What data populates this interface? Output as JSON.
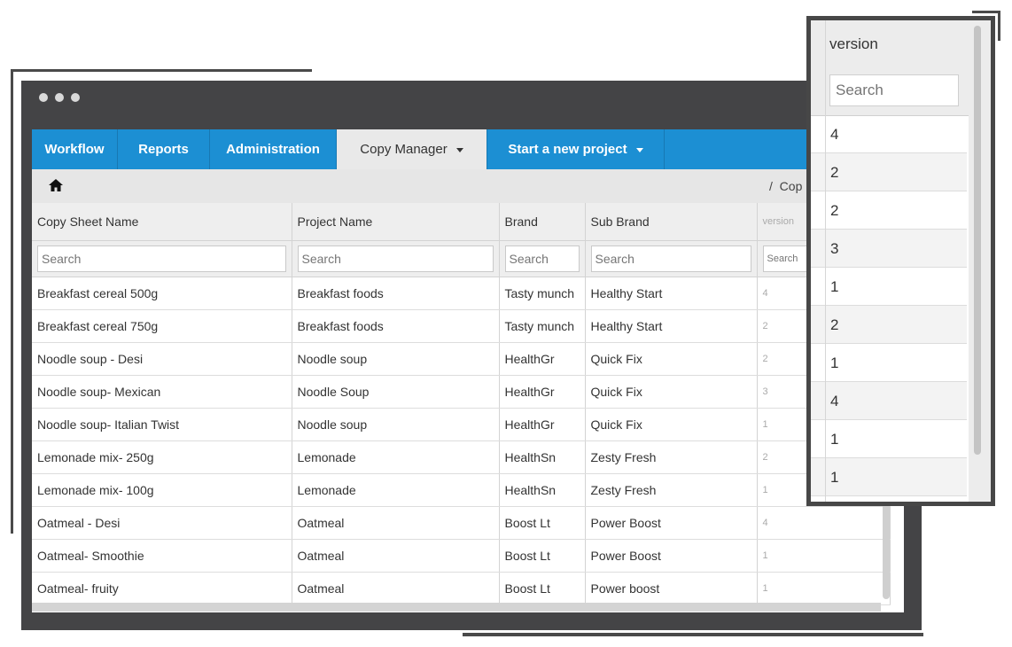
{
  "nav": {
    "workflow": "Workflow",
    "reports": "Reports",
    "administration": "Administration",
    "copy_manager": "Copy Manager",
    "start_project": "Start a new project"
  },
  "breadcrumb": {
    "separator": "/",
    "current": "Cop"
  },
  "table": {
    "columns": [
      "Copy Sheet Name",
      "Project Name",
      "Brand",
      "Sub Brand",
      "version"
    ],
    "search_placeholder": "Search",
    "rows": [
      [
        "Breakfast cereal 500g",
        "Breakfast foods",
        "Tasty munch",
        "Healthy Start",
        "4"
      ],
      [
        "Breakfast cereal 750g",
        "Breakfast foods",
        "Tasty munch",
        "Healthy Start",
        "2"
      ],
      [
        "Noodle soup - Desi",
        "Noodle soup",
        "HealthGr",
        "Quick Fix",
        "2"
      ],
      [
        "Noodle soup- Mexican",
        "Noodle Soup",
        "HealthGr",
        "Quick Fix",
        "3"
      ],
      [
        "Noodle soup- Italian Twist",
        "Noodle soup",
        "HealthGr",
        "Quick Fix",
        "1"
      ],
      [
        "Lemonade mix- 250g",
        "Lemonade",
        "HealthSn",
        "Zesty Fresh",
        "2"
      ],
      [
        "Lemonade mix- 100g",
        "Lemonade",
        "HealthSn",
        "Zesty Fresh",
        "1"
      ],
      [
        "Oatmeal - Desi",
        "Oatmeal",
        "Boost Lt",
        "Power Boost",
        "4"
      ],
      [
        "Oatmeal- Smoothie",
        "Oatmeal",
        "Boost Lt",
        "Power Boost",
        "1"
      ],
      [
        "Oatmeal- fruity",
        "Oatmeal",
        "Boost Lt",
        "Power boost",
        "1"
      ]
    ]
  },
  "zoom": {
    "header": "version",
    "search_placeholder": "Search",
    "values": [
      "4",
      "2",
      "2",
      "3",
      "1",
      "2",
      "1",
      "4",
      "1",
      "1"
    ]
  },
  "colors": {
    "nav_blue": "#1c8fd3",
    "window_frame": "#444446"
  }
}
